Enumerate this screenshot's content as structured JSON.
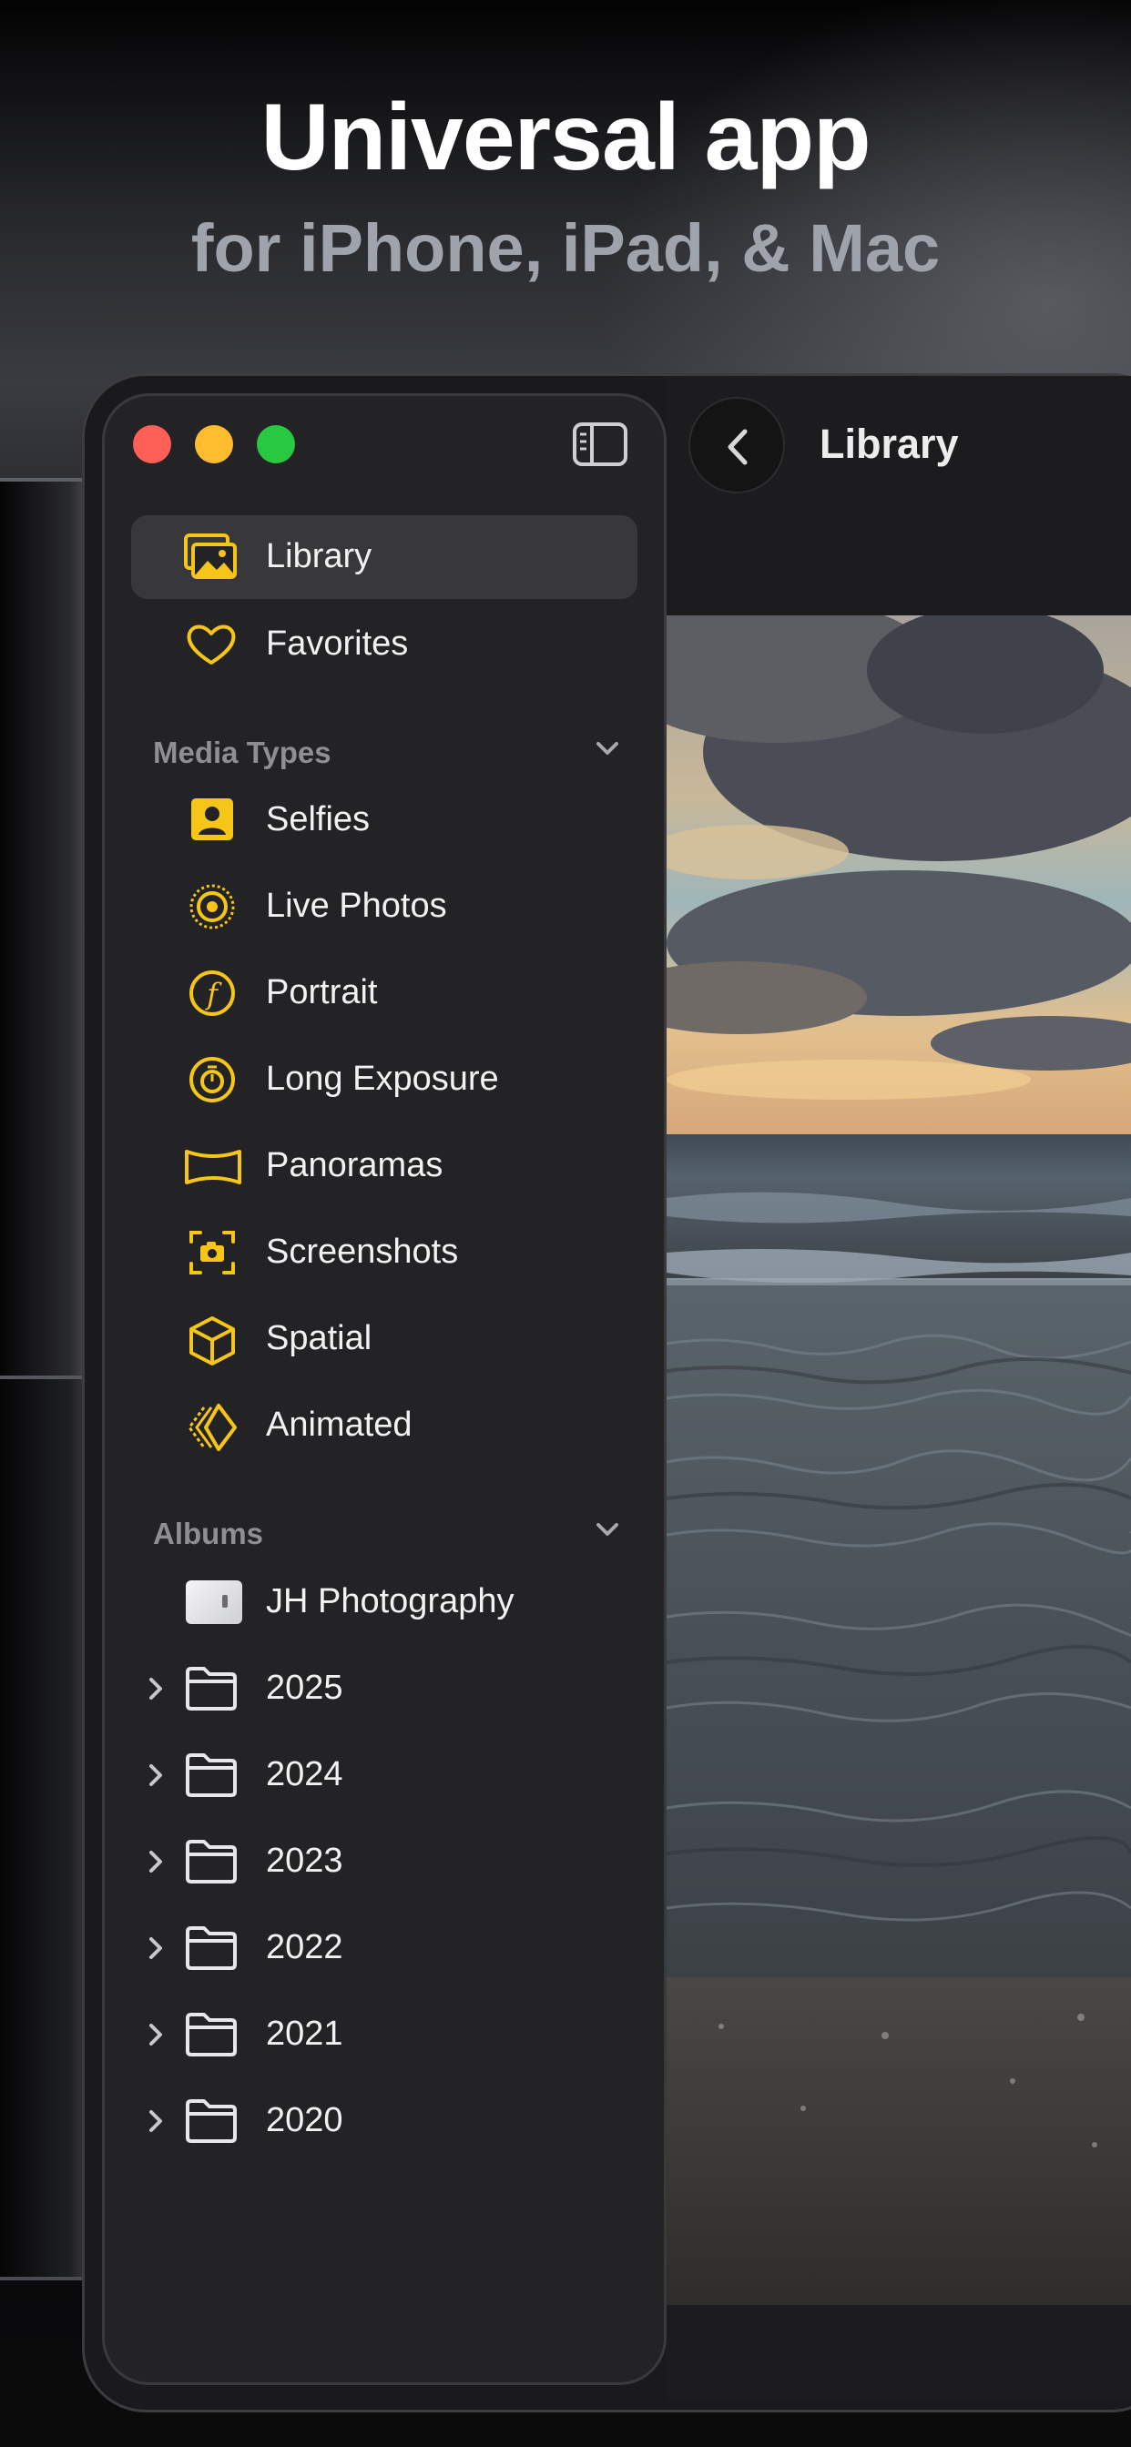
{
  "headline": "Universal app",
  "subheadline": "for iPhone, iPad, & Mac",
  "window": {
    "title": "Library"
  },
  "sidebar": {
    "top_items": [
      {
        "label": "Library",
        "icon": "photo-library-icon",
        "selected": true
      },
      {
        "label": "Favorites",
        "icon": "heart-icon",
        "selected": false
      }
    ],
    "media_types_header": "Media Types",
    "media_types": [
      {
        "label": "Selfies",
        "icon": "selfie-icon"
      },
      {
        "label": "Live Photos",
        "icon": "live-photo-icon"
      },
      {
        "label": "Portrait",
        "icon": "portrait-icon"
      },
      {
        "label": "Long Exposure",
        "icon": "long-exposure-icon"
      },
      {
        "label": "Panoramas",
        "icon": "panorama-icon"
      },
      {
        "label": "Screenshots",
        "icon": "screenshot-icon"
      },
      {
        "label": "Spatial",
        "icon": "spatial-cube-icon"
      },
      {
        "label": "Animated",
        "icon": "animated-icon"
      }
    ],
    "albums_header": "Albums",
    "albums": [
      {
        "label": "JH Photography",
        "icon": "album-thumbnail"
      }
    ],
    "folders": [
      {
        "label": "2025",
        "icon": "folder-icon"
      },
      {
        "label": "2024",
        "icon": "folder-icon"
      },
      {
        "label": "2023",
        "icon": "folder-icon"
      },
      {
        "label": "2022",
        "icon": "folder-icon"
      },
      {
        "label": "2021",
        "icon": "folder-icon"
      },
      {
        "label": "2020",
        "icon": "folder-icon"
      }
    ]
  },
  "colors": {
    "accent": "#f5c518",
    "sidebar_bg": "#232325",
    "text": "#f2f2f3",
    "section_header": "#8e8e93"
  }
}
